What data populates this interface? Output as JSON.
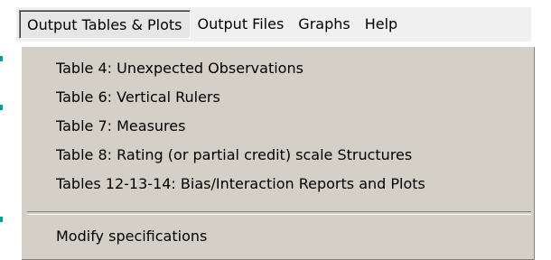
{
  "menubar": {
    "items": [
      {
        "label": "Output Tables & Plots",
        "active": true
      },
      {
        "label": "Output Files",
        "active": false
      },
      {
        "label": "Graphs",
        "active": false
      },
      {
        "label": "Help",
        "active": false
      }
    ]
  },
  "dropdown": {
    "items": [
      {
        "label": "Table 4: Unexpected Observations"
      },
      {
        "label": "Table 6: Vertical Rulers"
      },
      {
        "label": "Table 7: Measures"
      },
      {
        "label": "Table 8: Rating (or partial credit) scale Structures"
      },
      {
        "label": "Tables 12-13-14: Bias/Interaction Reports and Plots"
      }
    ],
    "after_separator": [
      {
        "label": "Modify specifications"
      }
    ]
  },
  "colors": {
    "menu_background": "#d4d0c8",
    "menubar_background": "#f0f0f0",
    "edge_marker": "#00a0a0"
  }
}
